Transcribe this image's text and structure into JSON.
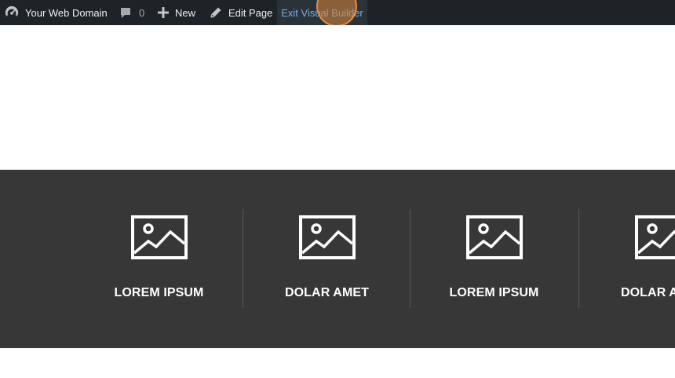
{
  "admin_bar": {
    "site_icon": "dashboard-icon",
    "site_name": "Your Web Domain",
    "comments_icon": "comment-bubble-icon",
    "comments_count": "0",
    "new_icon": "plus-icon",
    "new_label": "New",
    "edit_icon": "pencil-icon",
    "edit_label": "Edit Page",
    "exit_label": "Exit Visual Builder",
    "exit_color": "#72aee6",
    "bar_color": "#1d2327"
  },
  "features": {
    "background": "#373737",
    "icon": "image-placeholder-icon",
    "items": [
      {
        "title": "LOREM IPSUM"
      },
      {
        "title": "DOLAR AMET"
      },
      {
        "title": "LOREM IPSUM"
      },
      {
        "title": "DOLAR AMET"
      }
    ]
  }
}
